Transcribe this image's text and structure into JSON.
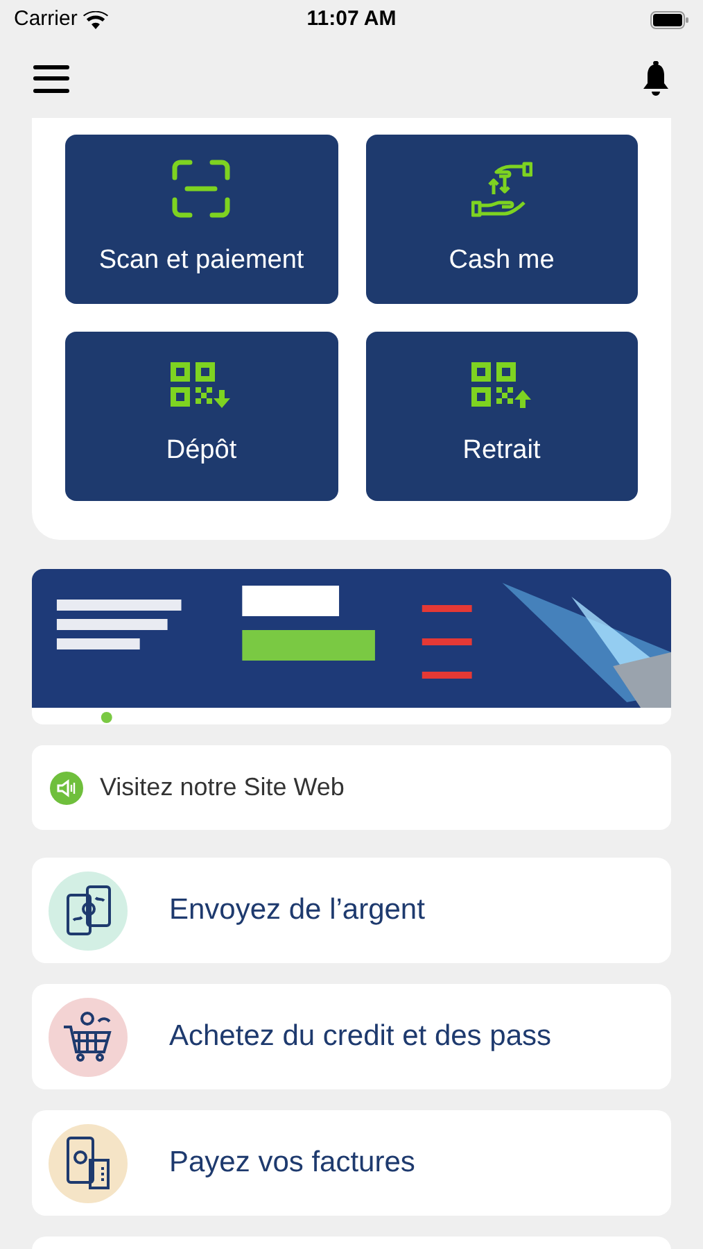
{
  "status_bar": {
    "carrier": "Carrier",
    "time": "11:07 AM"
  },
  "tiles": [
    {
      "label": "Scan et paiement",
      "kind": "scan"
    },
    {
      "label": "Cash me",
      "kind": "cash"
    },
    {
      "label": "Dépôt",
      "kind": "qr_down"
    },
    {
      "label": "Retrait",
      "kind": "qr_up"
    }
  ],
  "website_link": {
    "label": "Visitez notre Site Web"
  },
  "services": [
    {
      "label": "Envoyez de l’argent",
      "color": "#d3efe4",
      "kind": "phones"
    },
    {
      "label": "Achetez du credit et des pass",
      "color": "#f3d3d3",
      "kind": "cart"
    },
    {
      "label": "Payez vos factures",
      "color": "#f5e4c6",
      "kind": "bill"
    },
    {
      "kind": "partial"
    }
  ]
}
